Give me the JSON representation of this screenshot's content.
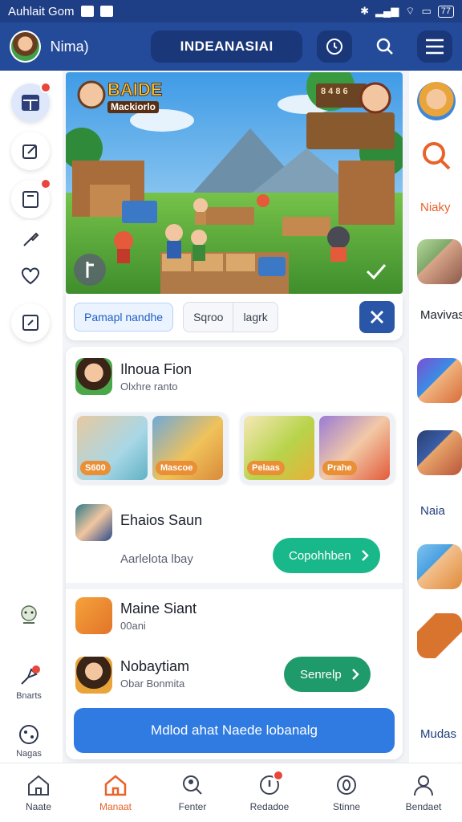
{
  "status_bar": {
    "left_text": "Auhlait Gom",
    "battery": "77"
  },
  "header": {
    "user_name": "Nima)",
    "title": "INDEANASIAI"
  },
  "rail": {
    "lower_items": [
      {
        "label": ""
      },
      {
        "label": "Bnarts"
      },
      {
        "label": "Nagas"
      }
    ]
  },
  "banner": {
    "badge_line1": "BAIDE",
    "badge_line2": "Mackiorlo",
    "sign_text": "8 4 8 6"
  },
  "chips": {
    "active": "Pamapl nandhe",
    "option1": "Sqroo",
    "option2": "lagrk"
  },
  "feed": {
    "item1": {
      "name": "Ilnoua Fion",
      "sub": "Olxhre ranto"
    },
    "promo_tags": [
      "S600",
      "Mascoe",
      "Pelaas",
      "Prahe"
    ],
    "item2": {
      "name": "Ehaios Saun",
      "sub": "Aarlelota lbay",
      "button": "Copohhben"
    },
    "item3": {
      "name": "Maine Siant",
      "sub": "00ani"
    },
    "item4": {
      "name": "Nobaytiam",
      "sub": "Obar Bonmita",
      "button": "Senrelp"
    },
    "cta": "Mdlod ahat Naede lobanalg"
  },
  "right_strip": {
    "label1": "Niaky",
    "label2": "Mavivas",
    "label3": "Naia",
    "label4": "Mudas"
  },
  "bottom_nav": [
    {
      "label": "Naate",
      "icon": "home-icon"
    },
    {
      "label": "Manaat",
      "icon": "home-active-icon"
    },
    {
      "label": "Fenter",
      "icon": "search-user-icon"
    },
    {
      "label": "Redadoe",
      "icon": "alert-icon"
    },
    {
      "label": "Stinne",
      "icon": "zero-icon"
    },
    {
      "label": "Bendaet",
      "icon": "profile-icon"
    }
  ],
  "colors": {
    "header": "#244a9a",
    "accent_green": "#19b88a",
    "accent_blue": "#2f7be2",
    "active_orange": "#e8622a"
  }
}
